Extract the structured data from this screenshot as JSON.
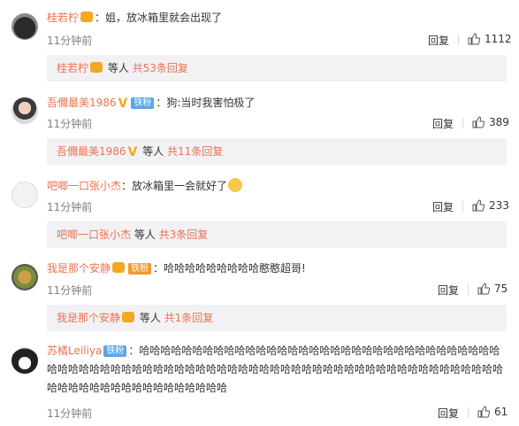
{
  "comments": [
    {
      "user": "桂若柠",
      "text": "：姐，放冰箱里就会出现了",
      "time": "11分钟前",
      "reply_label": "回复",
      "likes": "1112",
      "sub_user": "桂若柠",
      "sub_mid": " 等人 ",
      "sub_more": "共53条回复"
    },
    {
      "user": "吾儞最美1986",
      "fan_badge": "铁粉",
      "text": "：狗:当时我害怕极了",
      "time": "11分钟前",
      "reply_label": "回复",
      "likes": "389",
      "sub_user": "吾儞最美1986",
      "sub_mid": " 等人 ",
      "sub_more": "共11条回复"
    },
    {
      "user": "吧唧一口张小杰",
      "text": "：放冰箱里一会就好了",
      "time": "11分钟前",
      "reply_label": "回复",
      "likes": "233",
      "sub_user": "吧唧一口张小杰",
      "sub_mid": " 等人 ",
      "sub_more": "共3条回复"
    },
    {
      "user": "我是那个安静",
      "fan_badge": "铁粉",
      "text": "：哈哈哈哈哈哈哈哈哈憨憨超哥!",
      "time": "11分钟前",
      "reply_label": "回复",
      "likes": "75",
      "sub_user": "我是那个安静",
      "sub_mid": " 等人 ",
      "sub_more": "共1条回复"
    },
    {
      "user": "苏橘Leiliya",
      "fan_badge": "铁粉",
      "text": "：哈哈哈哈哈哈哈哈哈哈哈哈哈哈哈哈哈哈哈哈哈哈哈哈哈哈哈哈哈哈哈哈哈哈哈哈哈哈哈哈哈哈哈哈哈哈哈哈哈哈哈哈哈哈哈哈哈哈哈哈哈哈哈哈哈哈哈哈哈哈哈哈哈哈哈哈哈哈哈哈哈哈哈哈哈哈哈哈哈哈哈哈哈哈",
      "time": "11分钟前",
      "reply_label": "回复",
      "likes": "61"
    }
  ],
  "icons": {
    "like": "thumbs-up-icon",
    "crown_badge": "crown-badge-icon",
    "verified": "verified-v-icon",
    "emoji": "smiling-face-emoji"
  },
  "colors": {
    "username": "#eb7350",
    "secondary": "#808080",
    "sub_bg": "#f2f2f5",
    "fan_badge": "#59a7e8"
  }
}
